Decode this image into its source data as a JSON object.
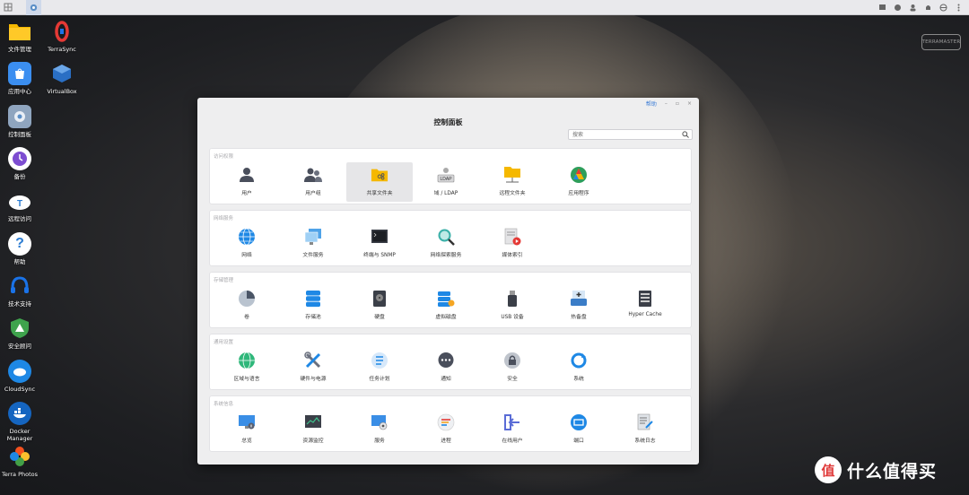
{
  "desktop": {
    "icons": [
      {
        "label": "文件管理",
        "color": "#f5b800"
      },
      {
        "label": "TerraSync",
        "color": "#e53935"
      },
      {
        "label": "应用中心",
        "color": "#3b8ef0"
      },
      {
        "label": "VirtualBox",
        "color": "#1e5fa8"
      },
      {
        "label": "控制面板",
        "color": "#5b8fc7"
      },
      {
        "label": "备份",
        "color": "#7d4dd1"
      },
      {
        "label": "远程访问",
        "color": "#4aa3f0"
      },
      {
        "label": "帮助",
        "color": "#2d7dd2"
      },
      {
        "label": "技术支持",
        "color": "#1a73e8"
      },
      {
        "label": "安全顾问",
        "color": "#3fa34d"
      },
      {
        "label": "CloudSync",
        "color": "#1e88e5"
      },
      {
        "label": "Docker Manager",
        "color": "#1565c0"
      },
      {
        "label": "Terra Photos",
        "color": "#f4511e"
      }
    ]
  },
  "brand": "TERRAMASTER",
  "window": {
    "title": "控制面板",
    "help_label": "帮助",
    "search_placeholder": "搜索",
    "sections": [
      {
        "title": "访问权限",
        "items": [
          "用户",
          "用户组",
          "共享文件夹",
          "域 / LDAP",
          "远程文件夹",
          "应用程序"
        ]
      },
      {
        "title": "网络服务",
        "items": [
          "网络",
          "文件服务",
          "终端与 SNMP",
          "网络探索服务",
          "媒体索引"
        ]
      },
      {
        "title": "存储管理",
        "items": [
          "卷",
          "存储池",
          "硬盘",
          "虚拟磁盘",
          "USB 设备",
          "热备盘",
          "Hyper Cache"
        ]
      },
      {
        "title": "通用设置",
        "items": [
          "区域与语言",
          "硬件与电源",
          "任务计划",
          "通知",
          "安全",
          "系统"
        ]
      },
      {
        "title": "系统信息",
        "items": [
          "总览",
          "资源监控",
          "服务",
          "进程",
          "在线用户",
          "端口",
          "系统日志"
        ]
      }
    ]
  },
  "watermark": {
    "logo": "值",
    "text": "什么值得买"
  }
}
